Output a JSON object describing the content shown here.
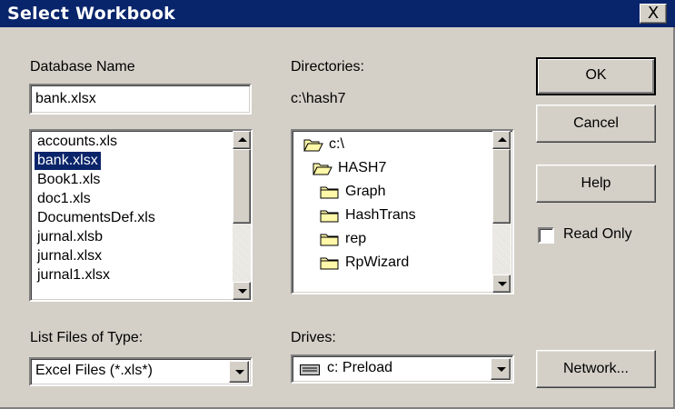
{
  "window": {
    "title": "Select Workbook",
    "close_symbol": "X"
  },
  "database_name": {
    "label": "Database Name",
    "value": "bank.xlsx",
    "files": [
      "accounts.xls",
      "bank.xlsx",
      "Book1.xls",
      "doc1.xls",
      "DocumentsDef.xls",
      "jurnal.xlsb",
      "jurnal.xlsx",
      "jurnal1.xlsx"
    ],
    "selected_file": "bank.xlsx"
  },
  "directories": {
    "label": "Directories:",
    "current_path": "c:\\hash7",
    "tree": [
      {
        "name": "c:\\",
        "icon": "open-folder-icon"
      },
      {
        "name": "HASH7",
        "icon": "open-folder-icon"
      },
      {
        "name": "Graph",
        "icon": "folder-icon"
      },
      {
        "name": "HashTrans",
        "icon": "folder-icon"
      },
      {
        "name": "rep",
        "icon": "folder-icon"
      },
      {
        "name": "RpWizard",
        "icon": "folder-icon"
      }
    ]
  },
  "file_type": {
    "label": "List Files of Type:",
    "value": "Excel Files (*.xls*)"
  },
  "drives": {
    "label": "Drives:",
    "value": "c: Preload",
    "icon": "drive-icon"
  },
  "buttons": {
    "ok": "OK",
    "cancel": "Cancel",
    "help": "Help",
    "network": "Network..."
  },
  "read_only": {
    "label": "Read Only",
    "checked": false
  },
  "colors": {
    "title_bar": "#08246b",
    "dialog_face": "#d4d0c8",
    "selection": "#0a246a",
    "folder": "#fff8a8"
  }
}
